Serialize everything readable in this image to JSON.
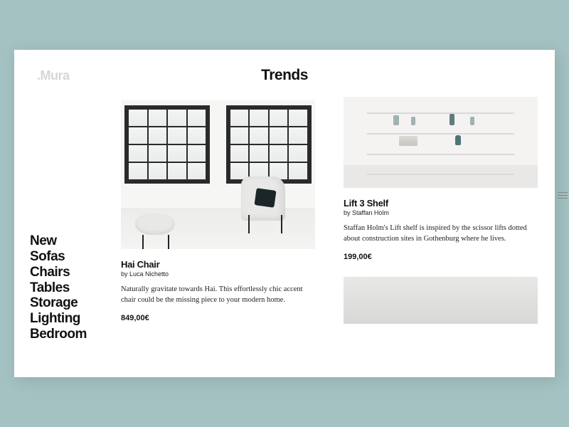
{
  "brand": ".Mura",
  "page_title": "Trends",
  "sidebar": {
    "items": [
      "New",
      "Sofas",
      "Chairs",
      "Tables",
      "Storage",
      "Lighting",
      "Bedroom"
    ]
  },
  "products": [
    {
      "title": "Hai Chair",
      "by": "by Luca Nichetto",
      "description": "Naturally gravitate towards Hai. This effortlessly chic accent chair could be the missing piece to your modern home.",
      "price": "849,00€"
    },
    {
      "title": "Lift 3 Shelf",
      "by": "by Staffan Holm",
      "description": "Staffan Holm's Lift shelf is inspired by the scissor lifts dotted about construction sites in Gothenburg where he lives.",
      "price": "199,00€"
    }
  ]
}
